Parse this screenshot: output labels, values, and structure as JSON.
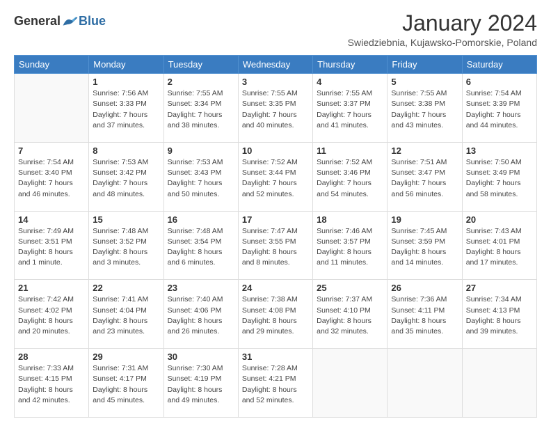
{
  "logo": {
    "general": "General",
    "blue": "Blue"
  },
  "title": "January 2024",
  "location": "Swiedziebnia, Kujawsko-Pomorskie, Poland",
  "weekdays": [
    "Sunday",
    "Monday",
    "Tuesday",
    "Wednesday",
    "Thursday",
    "Friday",
    "Saturday"
  ],
  "weeks": [
    [
      {
        "day": "",
        "info": ""
      },
      {
        "day": "1",
        "info": "Sunrise: 7:56 AM\nSunset: 3:33 PM\nDaylight: 7 hours\nand 37 minutes."
      },
      {
        "day": "2",
        "info": "Sunrise: 7:55 AM\nSunset: 3:34 PM\nDaylight: 7 hours\nand 38 minutes."
      },
      {
        "day": "3",
        "info": "Sunrise: 7:55 AM\nSunset: 3:35 PM\nDaylight: 7 hours\nand 40 minutes."
      },
      {
        "day": "4",
        "info": "Sunrise: 7:55 AM\nSunset: 3:37 PM\nDaylight: 7 hours\nand 41 minutes."
      },
      {
        "day": "5",
        "info": "Sunrise: 7:55 AM\nSunset: 3:38 PM\nDaylight: 7 hours\nand 43 minutes."
      },
      {
        "day": "6",
        "info": "Sunrise: 7:54 AM\nSunset: 3:39 PM\nDaylight: 7 hours\nand 44 minutes."
      }
    ],
    [
      {
        "day": "7",
        "info": "Sunrise: 7:54 AM\nSunset: 3:40 PM\nDaylight: 7 hours\nand 46 minutes."
      },
      {
        "day": "8",
        "info": "Sunrise: 7:53 AM\nSunset: 3:42 PM\nDaylight: 7 hours\nand 48 minutes."
      },
      {
        "day": "9",
        "info": "Sunrise: 7:53 AM\nSunset: 3:43 PM\nDaylight: 7 hours\nand 50 minutes."
      },
      {
        "day": "10",
        "info": "Sunrise: 7:52 AM\nSunset: 3:44 PM\nDaylight: 7 hours\nand 52 minutes."
      },
      {
        "day": "11",
        "info": "Sunrise: 7:52 AM\nSunset: 3:46 PM\nDaylight: 7 hours\nand 54 minutes."
      },
      {
        "day": "12",
        "info": "Sunrise: 7:51 AM\nSunset: 3:47 PM\nDaylight: 7 hours\nand 56 minutes."
      },
      {
        "day": "13",
        "info": "Sunrise: 7:50 AM\nSunset: 3:49 PM\nDaylight: 7 hours\nand 58 minutes."
      }
    ],
    [
      {
        "day": "14",
        "info": "Sunrise: 7:49 AM\nSunset: 3:51 PM\nDaylight: 8 hours\nand 1 minute."
      },
      {
        "day": "15",
        "info": "Sunrise: 7:48 AM\nSunset: 3:52 PM\nDaylight: 8 hours\nand 3 minutes."
      },
      {
        "day": "16",
        "info": "Sunrise: 7:48 AM\nSunset: 3:54 PM\nDaylight: 8 hours\nand 6 minutes."
      },
      {
        "day": "17",
        "info": "Sunrise: 7:47 AM\nSunset: 3:55 PM\nDaylight: 8 hours\nand 8 minutes."
      },
      {
        "day": "18",
        "info": "Sunrise: 7:46 AM\nSunset: 3:57 PM\nDaylight: 8 hours\nand 11 minutes."
      },
      {
        "day": "19",
        "info": "Sunrise: 7:45 AM\nSunset: 3:59 PM\nDaylight: 8 hours\nand 14 minutes."
      },
      {
        "day": "20",
        "info": "Sunrise: 7:43 AM\nSunset: 4:01 PM\nDaylight: 8 hours\nand 17 minutes."
      }
    ],
    [
      {
        "day": "21",
        "info": "Sunrise: 7:42 AM\nSunset: 4:02 PM\nDaylight: 8 hours\nand 20 minutes."
      },
      {
        "day": "22",
        "info": "Sunrise: 7:41 AM\nSunset: 4:04 PM\nDaylight: 8 hours\nand 23 minutes."
      },
      {
        "day": "23",
        "info": "Sunrise: 7:40 AM\nSunset: 4:06 PM\nDaylight: 8 hours\nand 26 minutes."
      },
      {
        "day": "24",
        "info": "Sunrise: 7:38 AM\nSunset: 4:08 PM\nDaylight: 8 hours\nand 29 minutes."
      },
      {
        "day": "25",
        "info": "Sunrise: 7:37 AM\nSunset: 4:10 PM\nDaylight: 8 hours\nand 32 minutes."
      },
      {
        "day": "26",
        "info": "Sunrise: 7:36 AM\nSunset: 4:11 PM\nDaylight: 8 hours\nand 35 minutes."
      },
      {
        "day": "27",
        "info": "Sunrise: 7:34 AM\nSunset: 4:13 PM\nDaylight: 8 hours\nand 39 minutes."
      }
    ],
    [
      {
        "day": "28",
        "info": "Sunrise: 7:33 AM\nSunset: 4:15 PM\nDaylight: 8 hours\nand 42 minutes."
      },
      {
        "day": "29",
        "info": "Sunrise: 7:31 AM\nSunset: 4:17 PM\nDaylight: 8 hours\nand 45 minutes."
      },
      {
        "day": "30",
        "info": "Sunrise: 7:30 AM\nSunset: 4:19 PM\nDaylight: 8 hours\nand 49 minutes."
      },
      {
        "day": "31",
        "info": "Sunrise: 7:28 AM\nSunset: 4:21 PM\nDaylight: 8 hours\nand 52 minutes."
      },
      {
        "day": "",
        "info": ""
      },
      {
        "day": "",
        "info": ""
      },
      {
        "day": "",
        "info": ""
      }
    ]
  ]
}
